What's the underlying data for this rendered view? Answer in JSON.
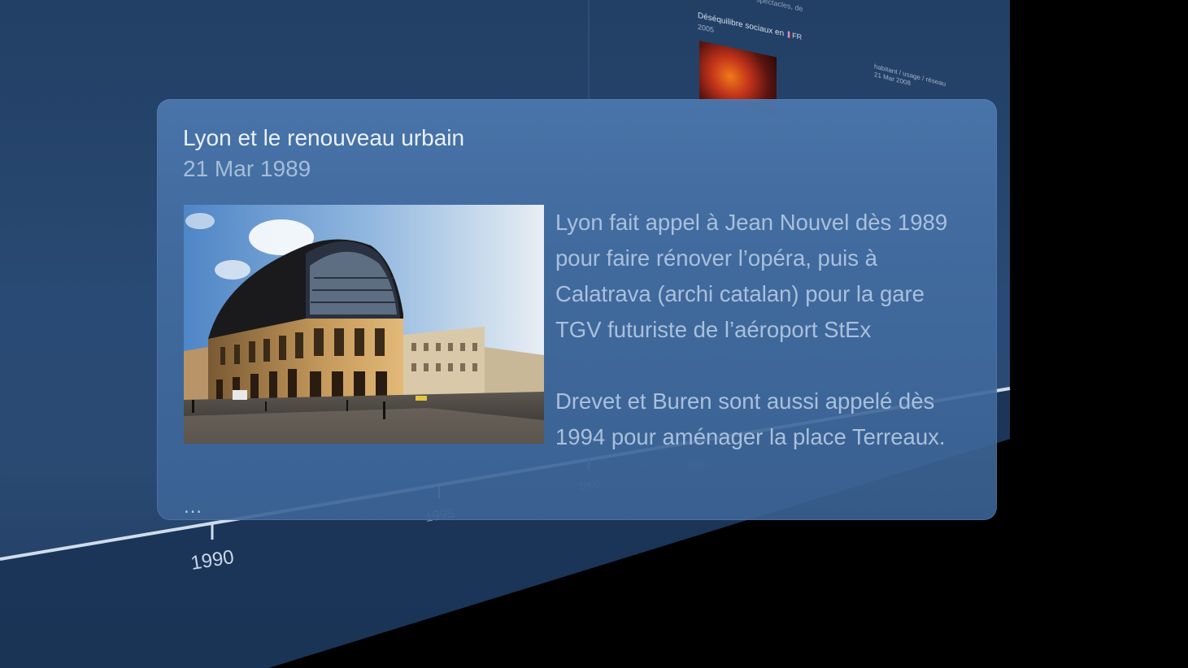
{
  "timeline": {
    "year_labels": [
      "1990",
      "1995",
      "2000",
      "2005"
    ],
    "background_event": {
      "title": "Déséquilibre sociaux en",
      "date": "2005",
      "country_code": "FR",
      "header_fragment": "spectacles, de",
      "side_label_line1": "habitant / usage / réseau",
      "side_label_line2": "21 Mar 2008"
    }
  },
  "popup": {
    "title": "Lyon et le renouveau urbain",
    "date": "21 Mar 1989",
    "image_alt": "Opéra de Lyon, Place de la Comédie",
    "paragraph1": "Lyon fait appel à Jean Nouvel dès 1989 pour faire rénover l’opéra, puis à Calatrava (archi catalan) pour la gare TGV futuriste de l’aéroport StEx",
    "paragraph2": "Drevet et Buren sont aussi appelé dès 1994 pour aménager la place Terreaux.",
    "ellipsis": "…"
  },
  "colors": {
    "wall": "#294a74",
    "popup_bg": "#4a76ac",
    "title_text": "#eaf1f9",
    "body_text": "#a9c0dc",
    "timeline_line": "#cfdcec"
  }
}
